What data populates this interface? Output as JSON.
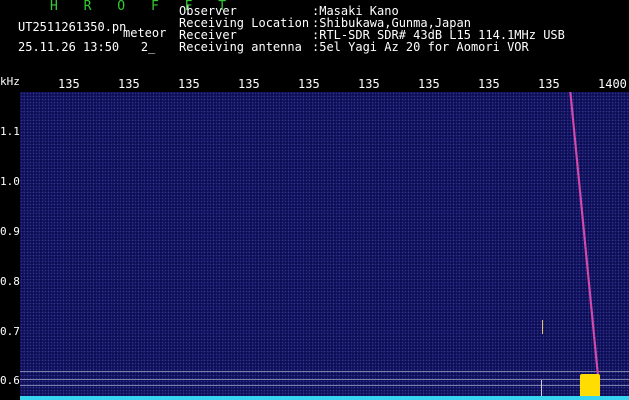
{
  "header": {
    "title": "H R O F F T",
    "filename": "UT2511261350.pn",
    "suffix": "meteor",
    "stamp": "25.11.26 13:50   2_",
    "fields": [
      {
        "label": "Observer",
        "value": ":Masaki Kano"
      },
      {
        "label": "Receiving Location",
        "value": ":Shibukawa,Gunma,Japan"
      },
      {
        "label": "Receiver",
        "value": ":RTL-SDR SDR# 43dB L15 114.1MHz USB"
      },
      {
        "label": "Receiving antenna",
        "value": ":5el Yagi Az 20 for Aomori VOR"
      }
    ]
  },
  "axes": {
    "x_ticks": [
      "135",
      "135",
      "135",
      "135",
      "135",
      "135",
      "135",
      "135",
      "135",
      "1400"
    ],
    "y_unit": "kHz",
    "y_ticks": [
      "1.1",
      "1.0",
      "0.9",
      "0.8",
      "0.7",
      "0.6"
    ]
  },
  "colors": {
    "background": "#0c0d52",
    "trace": "#e0409a",
    "baseline": "#36d4f0",
    "burst": "#ffdd00",
    "title": "#33cc33"
  }
}
